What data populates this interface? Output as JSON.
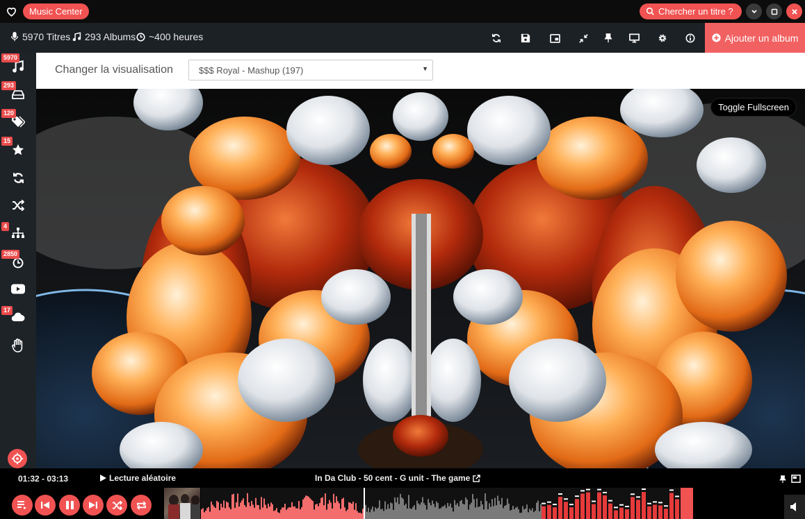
{
  "titlebar": {
    "app_title": "Music Center",
    "search_label": "Chercher un titre ?"
  },
  "stats": {
    "tracks": "5970 Titres",
    "albums": "293 Albums",
    "duration": "~400 heures"
  },
  "toolbar": {
    "add_album_label": "Ajouter un album"
  },
  "sidebar": {
    "items": [
      {
        "name": "music",
        "badge": "5970"
      },
      {
        "name": "albums",
        "badge": "293"
      },
      {
        "name": "tags",
        "badge": "120"
      },
      {
        "name": "favorites",
        "badge": "15"
      },
      {
        "name": "refresh",
        "badge": ""
      },
      {
        "name": "shuffle",
        "badge": ""
      },
      {
        "name": "sitemap",
        "badge": "4"
      },
      {
        "name": "history",
        "badge": "2850"
      },
      {
        "name": "youtube",
        "badge": ""
      },
      {
        "name": "cloud",
        "badge": "17"
      },
      {
        "name": "hand",
        "badge": ""
      }
    ]
  },
  "visualization": {
    "label": "Changer la visualisation",
    "selected": "$$$ Royal - Mashup (197)",
    "fullscreen_label": "Toggle Fullscreen"
  },
  "player": {
    "time": "01:32 - 03:13",
    "mode_label": "Lecture aléatoire",
    "now_playing": "In Da Club - 50 cent - G unit - The game",
    "progress": 0.33
  },
  "colors": {
    "accent": "#f15252",
    "sidebar_bg": "#1e2328",
    "statsbar_bg": "#1c2126"
  }
}
